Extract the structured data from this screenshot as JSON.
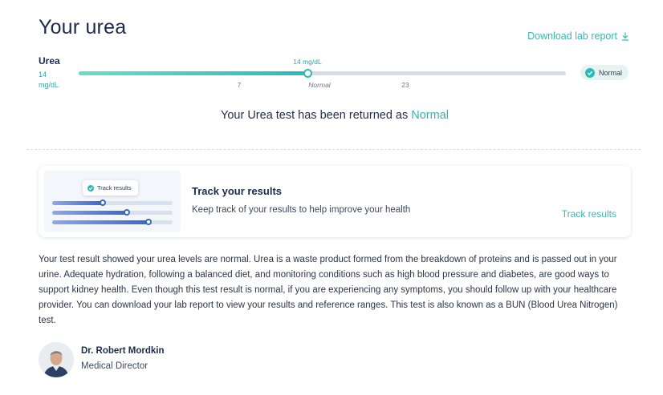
{
  "header": {
    "title": "Your urea",
    "download_label": "Download lab report",
    "download_icon": "download-arrow-icon"
  },
  "result": {
    "test_name": "Urea",
    "value_number": "14",
    "unit": "mg/dL",
    "value_with_unit": "14 mg/dL",
    "value": 14,
    "range_min": 7,
    "range_max": 23,
    "fill_fraction": 0.47,
    "tick_low": "7",
    "tick_current": "Normal",
    "tick_high": "23",
    "badge_label": "Normal",
    "badge_icon": "check-circle-icon"
  },
  "summary": {
    "prefix": "Your Urea test has been returned as",
    "status": "Normal"
  },
  "track_card": {
    "pill_label": "Track results",
    "title": "Track your results",
    "subtitle": "Keep track of your results to help improve your health",
    "link_label": "Track results",
    "illustration_bars": [
      0.42,
      0.62,
      0.8
    ]
  },
  "description": "Your test result showed your urea levels are normal. Urea is a waste product formed from the breakdown of proteins and is passed out in your urine. Adequate hydration, following a balanced diet, and monitoring conditions such as high blood pressure and diabetes, are good ways to support kidney health. Even though this test result is normal, if you are experiencing any symptoms, you should follow up with your healthcare provider. You can download your lab report to view your results and reference ranges. This test is also known as a BUN (Blood Urea Nitrogen) test.",
  "doctor": {
    "name": "Dr. Robert Mordkin",
    "role": "Medical Director"
  },
  "colors": {
    "accent": "#3bb7b2",
    "title": "#1c2a4e",
    "track": "#d5dde6",
    "badge_bg": "#e6f3f0"
  }
}
